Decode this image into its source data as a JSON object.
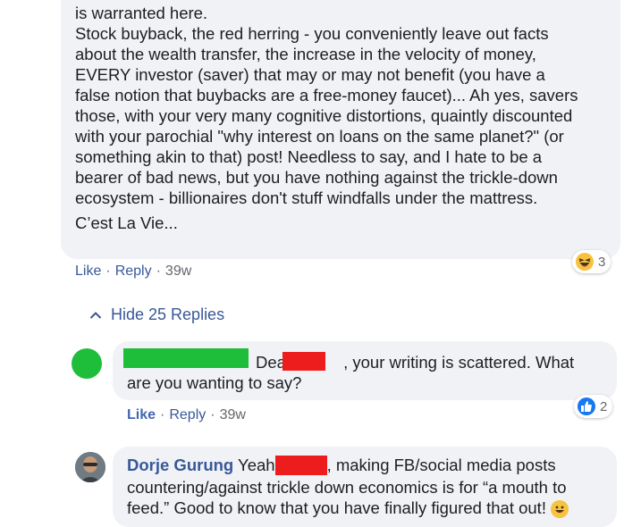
{
  "main_comment": {
    "text": "is warranted here.\nStock buyback, the red herring - you conveniently leave out facts\nabout the wealth transfer, the increase in the velocity of money,\nEVERY investor (saver) that may or may not benefit (you have a\nfalse notion that buybacks are a free-money faucet)... Ah yes, savers\nthose, with your very many cognitive distortions, quaintly discounted\nwith your parochial \"why interest on loans on the same planet?\" (or\nsomething akin to that) post! Needless to say, and I hate to be a\nbearer of bad news, but you have nothing against the trickle-down\necosystem - billionaires don't stuff windfalls under the mattress.",
    "signoff": "C’est La Vie...",
    "like": "Like",
    "reply": "Reply",
    "time": "39w",
    "reaction_count": "3",
    "reaction_icon": "haha-icon"
  },
  "hide_replies": {
    "label": "Hide 25 Replies",
    "icon": "chevron-up-icon"
  },
  "reply1": {
    "text_a": "Dear",
    "text_b": ", your writing is scattered. What\nare you wanting to say?",
    "like": "Like",
    "reply": "Reply",
    "time": "39w",
    "reaction_count": "2",
    "reaction_icon": "like-icon"
  },
  "reply2": {
    "name": "Dorje Gurung",
    "text_a": "Yeah",
    "text_b": ", making FB/social media posts\ncountering/against trickle down economics is for “a mouth to\nfeed.” Good to know that you have finally figured that out!"
  },
  "colors": {
    "bubble": "#f0f2f5",
    "link": "#385898",
    "like_active": "#4267b2",
    "redaction_green": "#1fbe3a",
    "redaction_red": "#ee1d1d"
  }
}
